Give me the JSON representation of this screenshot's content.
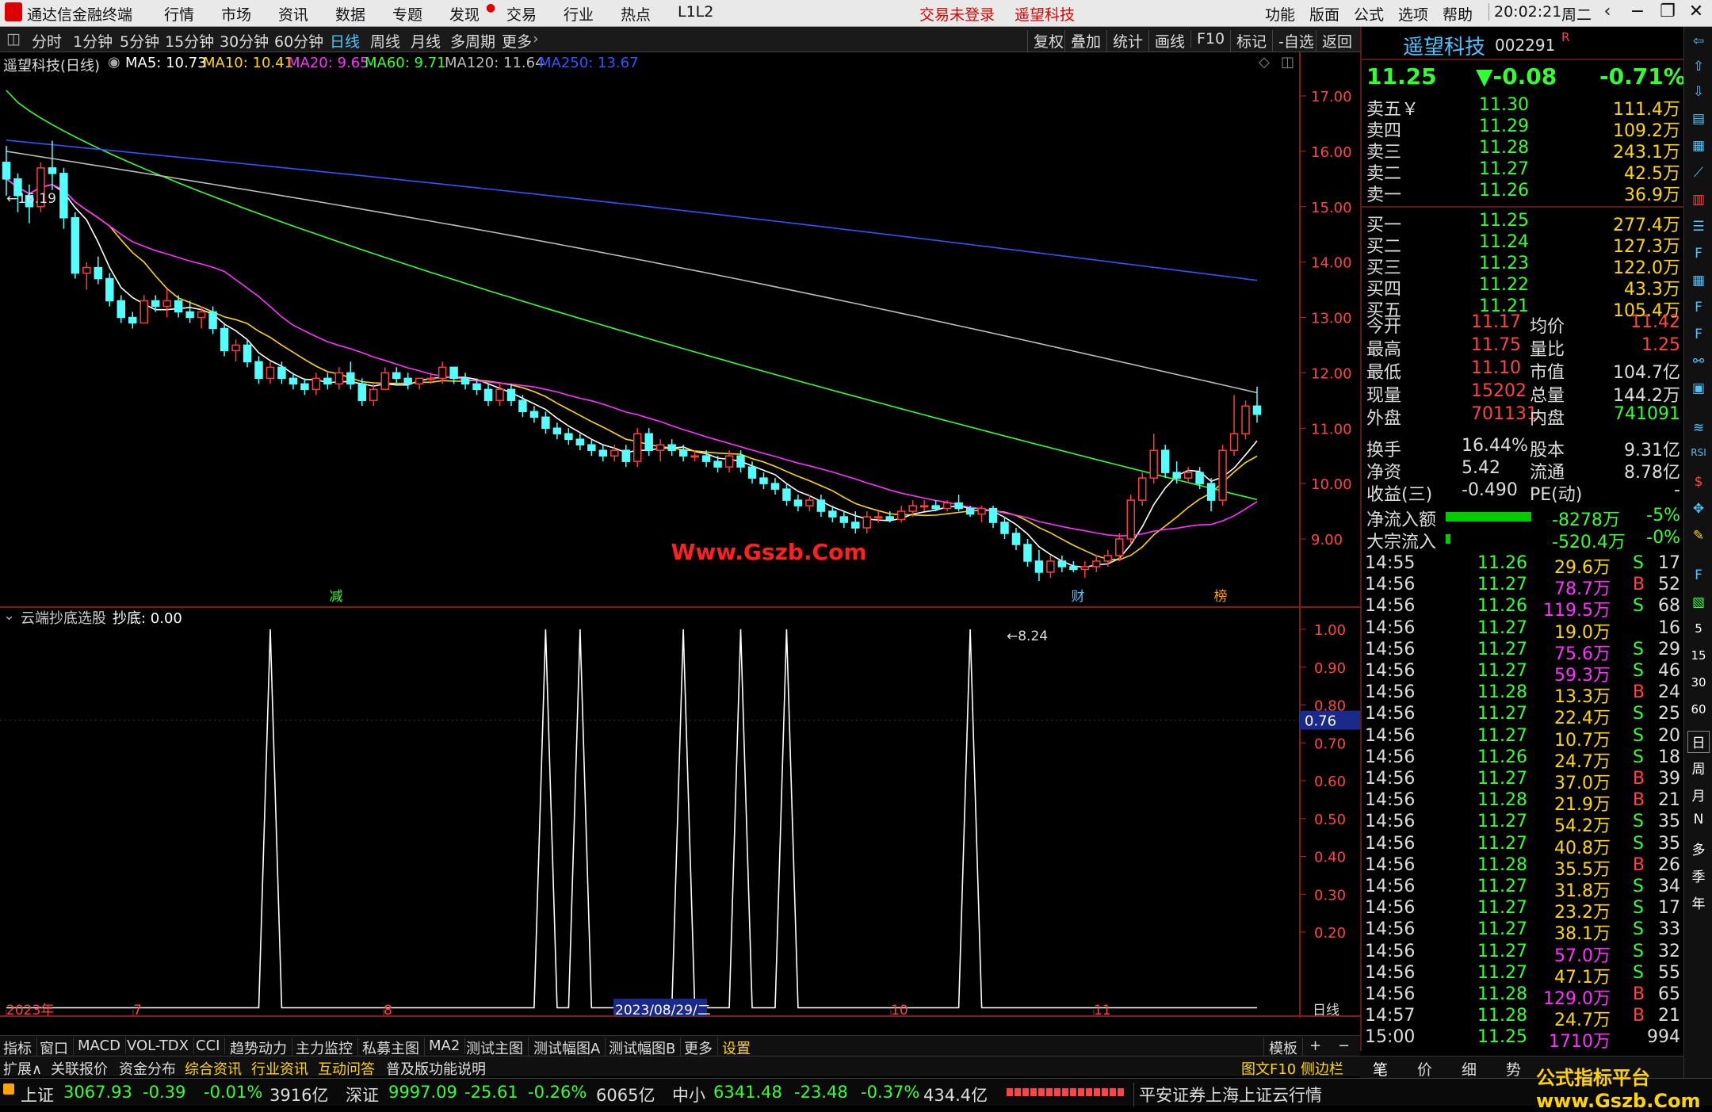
{
  "menubar": {
    "app_title": "通达信金融终端",
    "menus": [
      "行情",
      "市场",
      "资讯",
      "数据",
      "专题",
      "发现",
      "交易",
      "行业",
      "热点",
      "L1L2"
    ],
    "status_login": "交易未登录",
    "status_stock": "遥望科技",
    "right_menus": [
      "功能",
      "版面",
      "公式",
      "选项",
      "帮助"
    ],
    "clock": "20:02:21",
    "weekday": "周二"
  },
  "periods": [
    "分时",
    "1分钟",
    "5分钟",
    "15分钟",
    "30分钟",
    "60分钟",
    "日线",
    "周线",
    "月线",
    "多周期",
    "更多"
  ],
  "active_period": "日线",
  "toolbar_buttons": [
    "复权",
    "叠加",
    "统计",
    "画线",
    "F10",
    "标记",
    "-自选",
    "返回"
  ],
  "main_chart": {
    "title": "遥望科技(日线)",
    "ma_labels": [
      {
        "text": "MA5: 10.73",
        "color": "#ffffff"
      },
      {
        "text": "MA10: 10.41",
        "color": "#ffd700"
      },
      {
        "text": "MA20: 9.65",
        "color": "#ff33ff"
      },
      {
        "text": "MA60: 9.71",
        "color": "#33ff33"
      },
      {
        "text": "MA120: 11.64",
        "color": "#bbbbbb"
      },
      {
        "text": "MA250: 13.67",
        "color": "#3355ff"
      }
    ],
    "y_ticks": [
      "17.00",
      "16.00",
      "15.00",
      "14.00",
      "13.00",
      "12.00",
      "11.00",
      "10.00",
      "9.00"
    ],
    "max_label": "16.19",
    "min_label": "8.24",
    "markers": [
      "减",
      "财",
      "榜"
    ],
    "watermark": "Www.Gszb.Com"
  },
  "sub_chart": {
    "title": "云端抄底选股",
    "value_label": "抄底: 0.00",
    "y_ticks": [
      "1.00",
      "0.90",
      "0.80",
      "0.70",
      "0.60",
      "0.50",
      "0.40",
      "0.30",
      "0.20"
    ],
    "cursor_value": "0.76"
  },
  "x_axis": {
    "labels": [
      "2023年",
      "7",
      "8",
      "2023/08/29/二",
      "10",
      "11"
    ],
    "period_label": "日线"
  },
  "bottom_tabs": [
    "指标",
    "窗口",
    "MACD",
    "VOL-TDX",
    "CCI",
    "趋势动力",
    "主力监控",
    "私募主图",
    "MA2",
    "测试主图",
    "测试幅图A",
    "测试幅图B",
    "更多",
    "设置"
  ],
  "template_btn": "模板",
  "ext_tabs": [
    "扩展∧",
    "关联报价",
    "资金分布",
    "综合资讯",
    "行业资讯",
    "互动问答",
    "普及版功能说明"
  ],
  "ext_right": "图文F10  侧边栏 《",
  "quote": {
    "name": "遥望科技",
    "code": "002291",
    "flag": "R",
    "price": "11.25",
    "change": "▼-0.08",
    "pct": "-0.71%",
    "asks": [
      {
        "label": "卖五￥",
        "price": "11.30",
        "vol": "111.4万"
      },
      {
        "label": "卖四",
        "price": "11.29",
        "vol": "109.2万"
      },
      {
        "label": "卖三",
        "price": "11.28",
        "vol": "243.1万"
      },
      {
        "label": "卖二",
        "price": "11.27",
        "vol": "42.5万"
      },
      {
        "label": "卖一",
        "price": "11.26",
        "vol": "36.9万"
      }
    ],
    "bids": [
      {
        "label": "买一",
        "price": "11.25",
        "vol": "277.4万"
      },
      {
        "label": "买二",
        "price": "11.24",
        "vol": "127.3万"
      },
      {
        "label": "买三",
        "price": "11.23",
        "vol": "122.0万"
      },
      {
        "label": "买四",
        "price": "11.22",
        "vol": "43.3万"
      },
      {
        "label": "买五",
        "price": "11.21",
        "vol": "105.4万"
      }
    ],
    "stats": [
      {
        "l1": "今开",
        "v1": "11.17",
        "c1": "#ff4444",
        "l2": "均价",
        "v2": "11.42",
        "c2": "#ff4444"
      },
      {
        "l1": "最高",
        "v1": "11.75",
        "c1": "#ff4444",
        "l2": "量比",
        "v2": "1.25",
        "c2": "#ff4444"
      },
      {
        "l1": "最低",
        "v1": "11.10",
        "c1": "#ff4444",
        "l2": "市值",
        "v2": "104.7亿",
        "c2": "#dddddd"
      },
      {
        "l1": "现量",
        "v1": "15202",
        "c1": "#ff4444",
        "l2": "总量",
        "v2": "144.2万",
        "c2": "#dddddd"
      },
      {
        "l1": "外盘",
        "v1": "701131",
        "c1": "#ff4444",
        "l2": "内盘",
        "v2": "741091",
        "c2": "#33ff33"
      }
    ],
    "fin": [
      {
        "l1": "换手",
        "v1": "16.44%",
        "l2": "股本",
        "v2": "9.31亿"
      },
      {
        "l1": "净资",
        "v1": "5.42",
        "l2": "流通",
        "v2": "8.78亿"
      },
      {
        "l1": "收益(三)",
        "v1": "-0.490",
        "l2": "PE(动)",
        "v2": "-"
      }
    ],
    "flow": [
      {
        "label": "净流入额",
        "value": "-8278万",
        "pct": "-5%"
      },
      {
        "label": "大宗流入",
        "value": "-520.4万",
        "pct": "-0%"
      }
    ],
    "ticks": [
      {
        "t": "14:55",
        "p": "11.26",
        "v": "29.6万",
        "c": "#ffd700",
        "bs": "S",
        "n": "17"
      },
      {
        "t": "14:56",
        "p": "11.27",
        "v": "78.7万",
        "c": "#ff33ff",
        "bs": "B",
        "n": "52"
      },
      {
        "t": "14:56",
        "p": "11.26",
        "v": "119.5万",
        "c": "#ff33ff",
        "bs": "S",
        "n": "68"
      },
      {
        "t": "14:56",
        "p": "11.27",
        "v": "19.0万",
        "c": "#ffd700",
        "bs": "",
        "n": "16"
      },
      {
        "t": "14:56",
        "p": "11.27",
        "v": "75.6万",
        "c": "#ff33ff",
        "bs": "S",
        "n": "29"
      },
      {
        "t": "14:56",
        "p": "11.27",
        "v": "59.3万",
        "c": "#ff33ff",
        "bs": "S",
        "n": "46"
      },
      {
        "t": "14:56",
        "p": "11.28",
        "v": "13.3万",
        "c": "#ffd700",
        "bs": "B",
        "n": "24"
      },
      {
        "t": "14:56",
        "p": "11.27",
        "v": "22.4万",
        "c": "#ffd700",
        "bs": "S",
        "n": "25"
      },
      {
        "t": "14:56",
        "p": "11.27",
        "v": "10.7万",
        "c": "#ffd700",
        "bs": "S",
        "n": "20"
      },
      {
        "t": "14:56",
        "p": "11.26",
        "v": "24.7万",
        "c": "#ffd700",
        "bs": "S",
        "n": "18"
      },
      {
        "t": "14:56",
        "p": "11.27",
        "v": "37.0万",
        "c": "#ffd700",
        "bs": "B",
        "n": "39"
      },
      {
        "t": "14:56",
        "p": "11.28",
        "v": "21.9万",
        "c": "#ffd700",
        "bs": "B",
        "n": "21"
      },
      {
        "t": "14:56",
        "p": "11.27",
        "v": "54.2万",
        "c": "#ffd700",
        "bs": "S",
        "n": "35"
      },
      {
        "t": "14:56",
        "p": "11.27",
        "v": "40.8万",
        "c": "#ffd700",
        "bs": "S",
        "n": "35"
      },
      {
        "t": "14:56",
        "p": "11.28",
        "v": "35.5万",
        "c": "#ffd700",
        "bs": "B",
        "n": "26"
      },
      {
        "t": "14:56",
        "p": "11.27",
        "v": "31.8万",
        "c": "#ffd700",
        "bs": "S",
        "n": "34"
      },
      {
        "t": "14:56",
        "p": "11.27",
        "v": "23.2万",
        "c": "#ffd700",
        "bs": "S",
        "n": "17"
      },
      {
        "t": "14:56",
        "p": "11.27",
        "v": "38.1万",
        "c": "#ffd700",
        "bs": "S",
        "n": "33"
      },
      {
        "t": "14:56",
        "p": "11.27",
        "v": "57.0万",
        "c": "#ff33ff",
        "bs": "S",
        "n": "32"
      },
      {
        "t": "14:56",
        "p": "11.27",
        "v": "47.1万",
        "c": "#ffd700",
        "bs": "S",
        "n": "55"
      },
      {
        "t": "14:56",
        "p": "11.28",
        "v": "129.0万",
        "c": "#ff33ff",
        "bs": "B",
        "n": "65"
      },
      {
        "t": "14:57",
        "p": "11.28",
        "v": "24.7万",
        "c": "#ffd700",
        "bs": "B",
        "n": "21"
      },
      {
        "t": "15:00",
        "p": "11.25",
        "v": "1710万",
        "c": "#ff33ff",
        "bs": "",
        "n": "994"
      }
    ]
  },
  "rp_bottom_tabs": [
    "笔",
    "价",
    "细",
    "势"
  ],
  "statusbar": {
    "items": [
      {
        "name": "上证",
        "val": "3067.93",
        "chg": "-0.39",
        "pct": "-0.01%",
        "amt": "3916亿"
      },
      {
        "name": "深证",
        "val": "9997.09",
        "chg": "-25.61",
        "pct": "-0.26%",
        "amt": "6065亿"
      },
      {
        "name": "中小",
        "val": "6341.48",
        "chg": "-23.48",
        "pct": "-0.37%",
        "amt": "434.4亿"
      }
    ],
    "info": "平安证券上海上证云行情"
  },
  "side_tools": [
    "日",
    "周",
    "月",
    "N",
    "多",
    "季",
    "年",
    "15",
    "30",
    "60"
  ],
  "watermark_bottom": "公式指标平台 www.Gszb.Com",
  "chart_data": [
    {
      "type": "candlestick",
      "title": "遥望科技(日线)",
      "ylim": [
        8.0,
        17.3
      ],
      "candles_ohlc": [
        [
          15.8,
          16.1,
          15.2,
          15.5
        ],
        [
          15.5,
          15.6,
          14.9,
          15.2
        ],
        [
          15.2,
          15.4,
          14.7,
          15.0
        ],
        [
          15.0,
          15.8,
          14.9,
          15.7
        ],
        [
          15.7,
          16.19,
          15.3,
          15.6
        ],
        [
          15.6,
          15.7,
          14.6,
          14.8
        ],
        [
          14.8,
          14.9,
          13.7,
          13.8
        ],
        [
          13.8,
          14.0,
          13.5,
          13.9
        ],
        [
          13.9,
          14.1,
          13.6,
          13.7
        ],
        [
          13.7,
          13.8,
          13.2,
          13.3
        ],
        [
          13.3,
          13.4,
          12.9,
          13.0
        ],
        [
          13.0,
          13.1,
          12.8,
          12.9
        ],
        [
          12.9,
          13.4,
          12.9,
          13.3
        ],
        [
          13.3,
          13.4,
          13.1,
          13.2
        ],
        [
          13.2,
          13.5,
          13.0,
          13.3
        ],
        [
          13.3,
          13.4,
          13.0,
          13.1
        ],
        [
          13.1,
          13.3,
          12.9,
          13.0
        ],
        [
          13.0,
          13.2,
          12.8,
          13.1
        ],
        [
          13.1,
          13.2,
          12.7,
          12.8
        ],
        [
          12.8,
          12.9,
          12.3,
          12.4
        ],
        [
          12.4,
          12.6,
          12.2,
          12.5
        ],
        [
          12.5,
          12.6,
          12.1,
          12.2
        ],
        [
          12.2,
          12.3,
          11.8,
          11.9
        ],
        [
          11.9,
          12.2,
          11.8,
          12.1
        ],
        [
          12.1,
          12.2,
          11.8,
          11.9
        ],
        [
          11.9,
          12.0,
          11.7,
          11.8
        ],
        [
          11.8,
          11.9,
          11.6,
          11.7
        ],
        [
          11.7,
          12.0,
          11.6,
          11.9
        ],
        [
          11.9,
          12.0,
          11.7,
          11.8
        ],
        [
          11.8,
          12.1,
          11.7,
          12.0
        ],
        [
          12.0,
          12.2,
          11.7,
          11.8
        ],
        [
          11.8,
          11.9,
          11.4,
          11.5
        ],
        [
          11.5,
          11.8,
          11.4,
          11.7
        ],
        [
          11.7,
          12.1,
          11.7,
          12.0
        ],
        [
          12.0,
          12.1,
          11.8,
          11.9
        ],
        [
          11.9,
          12.0,
          11.7,
          11.8
        ],
        [
          11.8,
          11.9,
          11.7,
          11.9
        ],
        [
          11.9,
          12.0,
          11.8,
          11.9
        ],
        [
          11.9,
          12.2,
          11.8,
          12.1
        ],
        [
          12.1,
          12.1,
          11.8,
          11.9
        ],
        [
          11.9,
          12.0,
          11.7,
          11.8
        ],
        [
          11.8,
          11.9,
          11.6,
          11.7
        ],
        [
          11.7,
          11.8,
          11.4,
          11.5
        ],
        [
          11.5,
          11.8,
          11.4,
          11.7
        ],
        [
          11.7,
          11.8,
          11.4,
          11.5
        ],
        [
          11.5,
          11.6,
          11.2,
          11.3
        ],
        [
          11.3,
          11.4,
          11.1,
          11.2
        ],
        [
          11.2,
          11.3,
          10.9,
          11.0
        ],
        [
          11.0,
          11.1,
          10.8,
          10.9
        ],
        [
          10.9,
          11.0,
          10.7,
          10.8
        ],
        [
          10.8,
          10.9,
          10.6,
          10.7
        ],
        [
          10.7,
          10.8,
          10.5,
          10.6
        ],
        [
          10.6,
          10.7,
          10.4,
          10.5
        ],
        [
          10.5,
          10.7,
          10.4,
          10.6
        ],
        [
          10.6,
          10.7,
          10.3,
          10.4
        ],
        [
          10.4,
          11.0,
          10.3,
          10.9
        ],
        [
          10.9,
          11.0,
          10.5,
          10.6
        ],
        [
          10.6,
          10.8,
          10.4,
          10.7
        ],
        [
          10.7,
          10.8,
          10.5,
          10.6
        ],
        [
          10.6,
          10.7,
          10.4,
          10.5
        ],
        [
          10.5,
          10.6,
          10.4,
          10.5
        ],
        [
          10.5,
          10.6,
          10.3,
          10.4
        ],
        [
          10.4,
          10.5,
          10.2,
          10.3
        ],
        [
          10.3,
          10.6,
          10.2,
          10.5
        ],
        [
          10.5,
          10.6,
          10.2,
          10.3
        ],
        [
          10.3,
          10.4,
          10.0,
          10.1
        ],
        [
          10.1,
          10.2,
          9.9,
          10.0
        ],
        [
          10.0,
          10.1,
          9.8,
          9.9
        ],
        [
          9.9,
          10.0,
          9.6,
          9.7
        ],
        [
          9.7,
          9.8,
          9.5,
          9.6
        ],
        [
          9.6,
          9.8,
          9.5,
          9.7
        ],
        [
          9.7,
          9.8,
          9.4,
          9.5
        ],
        [
          9.5,
          9.6,
          9.3,
          9.4
        ],
        [
          9.4,
          9.5,
          9.2,
          9.3
        ],
        [
          9.3,
          9.5,
          9.1,
          9.2
        ],
        [
          9.2,
          9.5,
          9.1,
          9.4
        ],
        [
          9.4,
          9.5,
          9.3,
          9.4
        ],
        [
          9.4,
          9.5,
          9.3,
          9.35
        ],
        [
          9.35,
          9.6,
          9.3,
          9.5
        ],
        [
          9.5,
          9.7,
          9.4,
          9.6
        ],
        [
          9.6,
          9.7,
          9.5,
          9.6
        ],
        [
          9.6,
          9.7,
          9.5,
          9.55
        ],
        [
          9.55,
          9.7,
          9.5,
          9.65
        ],
        [
          9.65,
          9.8,
          9.5,
          9.55
        ],
        [
          9.55,
          9.6,
          9.4,
          9.45
        ],
        [
          9.45,
          9.6,
          9.3,
          9.55
        ],
        [
          9.55,
          9.6,
          9.2,
          9.3
        ],
        [
          9.3,
          9.4,
          9.0,
          9.1
        ],
        [
          9.1,
          9.2,
          8.8,
          8.9
        ],
        [
          8.9,
          9.0,
          8.5,
          8.6
        ],
        [
          8.6,
          8.8,
          8.24,
          8.4
        ],
        [
          8.4,
          8.7,
          8.3,
          8.6
        ],
        [
          8.6,
          8.7,
          8.4,
          8.5
        ],
        [
          8.5,
          8.6,
          8.4,
          8.45
        ],
        [
          8.45,
          8.6,
          8.3,
          8.5
        ],
        [
          8.5,
          8.7,
          8.4,
          8.6
        ],
        [
          8.6,
          8.8,
          8.5,
          8.7
        ],
        [
          8.7,
          9.1,
          8.6,
          9.0
        ],
        [
          9.0,
          9.8,
          8.9,
          9.7
        ],
        [
          9.7,
          10.2,
          9.6,
          10.1
        ],
        [
          10.1,
          10.9,
          10.0,
          10.6
        ],
        [
          10.6,
          10.7,
          10.1,
          10.2
        ],
        [
          10.2,
          10.4,
          10.0,
          10.1
        ],
        [
          10.1,
          10.3,
          10.0,
          10.2
        ],
        [
          10.2,
          10.3,
          9.9,
          10.0
        ],
        [
          10.0,
          10.1,
          9.5,
          9.7
        ],
        [
          9.7,
          10.7,
          9.6,
          10.6
        ],
        [
          10.6,
          11.6,
          10.5,
          10.9
        ],
        [
          10.9,
          11.5,
          10.8,
          11.4
        ],
        [
          11.4,
          11.75,
          11.1,
          11.25
        ]
      ],
      "ma_series": [
        {
          "name": "MA5",
          "color": "#ffffff"
        },
        {
          "name": "MA10",
          "color": "#ffd700"
        },
        {
          "name": "MA20",
          "color": "#ff33ff"
        },
        {
          "name": "MA60",
          "color": "#33ff33"
        },
        {
          "name": "MA120",
          "color": "#bbbbbb"
        },
        {
          "name": "MA250",
          "color": "#3355ff"
        }
      ]
    },
    {
      "type": "line",
      "title": "云端抄底选股",
      "ylim": [
        0,
        1.05
      ],
      "spike_bar_indices": [
        23,
        47,
        50,
        59,
        64,
        68,
        84
      ],
      "bar_count": 105
    }
  ]
}
